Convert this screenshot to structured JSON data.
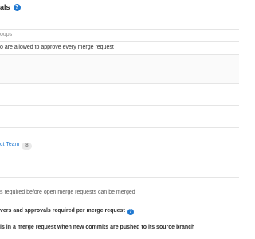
{
  "section": {
    "title": "als",
    "groups_label": "oups",
    "approve_description": "o are allowed to approve every merge request"
  },
  "team": {
    "name": "ct Team",
    "member_count": "8"
  },
  "approvals_required_text": "s required before open merge requests can be merged",
  "settings": {
    "approvers_label": "vers and approvals required per merge request",
    "reset_label": "ls in a merge request when new commits are pushed to its source branch"
  }
}
